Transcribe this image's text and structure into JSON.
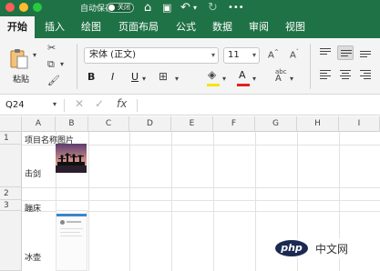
{
  "titlebar": {
    "autosave_label": "自动保存",
    "autosave_state": "关闭",
    "colors": {
      "bar": "#1f7246",
      "close": "#ff5f57",
      "minimize": "#febc2e",
      "zoom": "#28c840"
    }
  },
  "tabs": [
    {
      "label": "开始",
      "active": true
    },
    {
      "label": "插入",
      "active": false
    },
    {
      "label": "绘图",
      "active": false
    },
    {
      "label": "页面布局",
      "active": false
    },
    {
      "label": "公式",
      "active": false
    },
    {
      "label": "数据",
      "active": false
    },
    {
      "label": "审阅",
      "active": false
    },
    {
      "label": "视图",
      "active": false
    }
  ],
  "ribbon": {
    "paste_label": "粘贴",
    "font_name": "宋体 (正文)",
    "font_size": "11",
    "bold": "B",
    "italic": "I",
    "underline": "U",
    "grow_font": "A",
    "shrink_font": "A",
    "font_color": "A",
    "phonetic": "abc",
    "font_color_value": "#e02020",
    "highlight_color_value": "#f5e400"
  },
  "formula_bar": {
    "name_box": "Q24",
    "fx": "fx"
  },
  "grid": {
    "columns": [
      "A",
      "B",
      "C",
      "D",
      "E",
      "F",
      "G",
      "H",
      "I"
    ],
    "rows": [
      {
        "num": "1",
        "a": "项目名称",
        "b": "图片"
      },
      {
        "num": "",
        "a": "击剑",
        "b": ""
      },
      {
        "num": "2",
        "a": "",
        "b": ""
      },
      {
        "num": "3",
        "a": "蹦床",
        "b": ""
      },
      {
        "num": "",
        "a": "冰壶",
        "b": ""
      }
    ]
  },
  "watermark": {
    "badge": "php",
    "text": "中文网"
  }
}
